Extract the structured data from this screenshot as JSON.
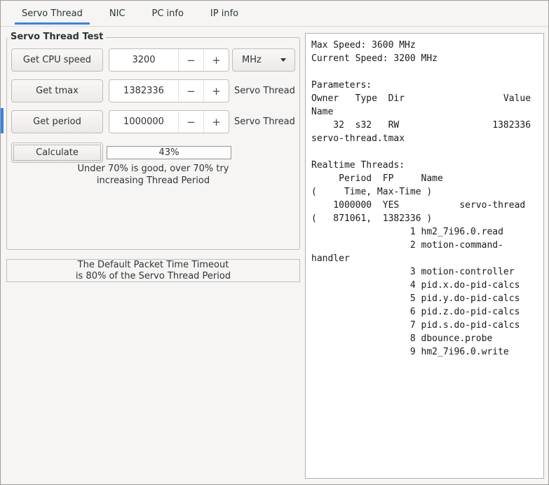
{
  "window": {
    "accent": "#3584e4"
  },
  "tabs": [
    {
      "label": "Servo Thread",
      "active": true
    },
    {
      "label": "NIC",
      "active": false
    },
    {
      "label": "PC info",
      "active": false
    },
    {
      "label": "IP info",
      "active": false
    }
  ],
  "icons": {
    "minus": "−",
    "plus": "+"
  },
  "panel": {
    "title": "Servo Thread Test",
    "cpu_row": {
      "button": "Get CPU speed",
      "value": "3200",
      "unit": "MHz"
    },
    "tmax_row": {
      "button": "Get tmax",
      "value": "1382336",
      "label": "Servo Thread"
    },
    "period_row": {
      "button": "Get period",
      "value": "1000000",
      "label": "Servo Thread"
    },
    "calc_row": {
      "button": "Calculate",
      "result": "43%"
    },
    "hint": [
      "Under 70% is good, over 70% try",
      "increasing Thread Period"
    ]
  },
  "notice": [
    "The Default Packet Time Timeout",
    "is 80% of the Servo Thread Period"
  ],
  "output": {
    "lines": [
      "Max Speed: 3600 MHz",
      "Current Speed: 3200 MHz",
      "",
      "Parameters:",
      "Owner   Type  Dir                  Value",
      "Name",
      "    32  s32   RW                 1382336",
      "servo-thread.tmax",
      "",
      "Realtime Threads:",
      "     Period  FP     Name",
      "(     Time, Max-Time )",
      "    1000000  YES           servo-thread",
      "(   871061,  1382336 )",
      "                  1 hm2_7i96.0.read",
      "                  2 motion-command-",
      "handler",
      "                  3 motion-controller",
      "                  4 pid.x.do-pid-calcs",
      "                  5 pid.y.do-pid-calcs",
      "                  6 pid.z.do-pid-calcs",
      "                  7 pid.s.do-pid-calcs",
      "                  8 dbounce.probe",
      "                  9 hm2_7i96.0.write"
    ]
  }
}
